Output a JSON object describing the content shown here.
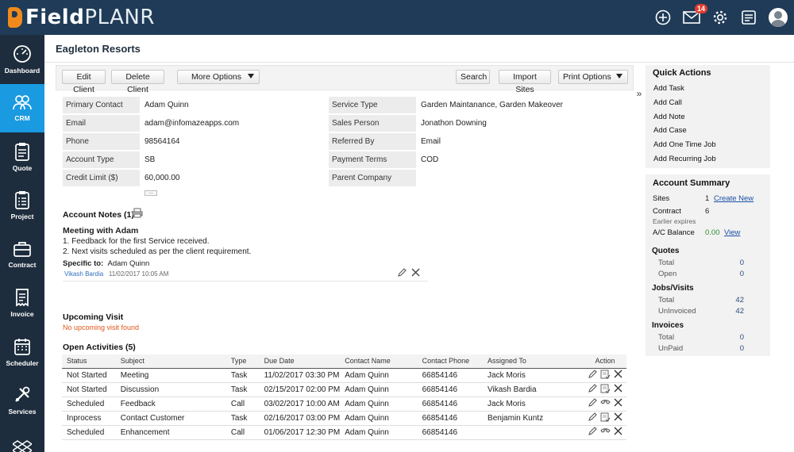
{
  "brand": {
    "bold": "Field",
    "light": "PLANR"
  },
  "topbar": {
    "notification_count": "14"
  },
  "sidebar": {
    "items": [
      {
        "label": "Dashboard",
        "icon": "gauge-icon",
        "active": false
      },
      {
        "label": "CRM",
        "icon": "people-icon",
        "active": true
      },
      {
        "label": "Quote",
        "icon": "clipboard-icon",
        "active": false
      },
      {
        "label": "Project",
        "icon": "clipboard-list-icon",
        "active": false
      },
      {
        "label": "Contract",
        "icon": "briefcase-icon",
        "active": false
      },
      {
        "label": "Invoice",
        "icon": "invoice-icon",
        "active": false
      },
      {
        "label": "Scheduler",
        "icon": "calendar-icon",
        "active": false
      },
      {
        "label": "Services",
        "icon": "tools-icon",
        "active": false
      },
      {
        "label": "",
        "icon": "dropbox-icon",
        "active": false
      }
    ]
  },
  "page": {
    "title": "Eagleton Resorts"
  },
  "toolbar": {
    "edit_client": "Edit Client",
    "delete_client": "Delete Client",
    "more_options": "More Options",
    "search": "Search",
    "import_sites": "Import Sites",
    "print_options": "Print Options"
  },
  "collapse_toggle": "»",
  "details": {
    "left": [
      {
        "label": "Primary Contact",
        "value": "Adam Quinn"
      },
      {
        "label": "Email",
        "value": "adam@infomazeapps.com"
      },
      {
        "label": "Phone",
        "value": "98564164"
      },
      {
        "label": "Account Type",
        "value": "SB"
      },
      {
        "label": "Credit Limit ($)",
        "value": "60,000.00"
      }
    ],
    "right": [
      {
        "label": "Service Type",
        "value": "Garden Maintanance, Garden Makeover"
      },
      {
        "label": "Sales Person",
        "value": "Jonathon Downing"
      },
      {
        "label": "Referred By",
        "value": "Email"
      },
      {
        "label": "Payment Terms",
        "value": "COD"
      },
      {
        "label": "Parent Company",
        "value": ""
      }
    ],
    "more_dots": "..."
  },
  "notes": {
    "heading": "Account Notes (1)",
    "title": "Meeting with Adam",
    "lines": [
      "1. Feedback for the first Service received.",
      "2. Next visits scheduled as per the client requirement."
    ],
    "specific_label": "Specific to:",
    "specific_value": "Adam Quinn",
    "author": "Vikash Bardia",
    "timestamp": "11/02/2017 10:05 AM"
  },
  "upcoming": {
    "heading": "Upcoming Visit",
    "empty_text": "No upcoming visit found"
  },
  "activities": {
    "heading": "Open Activities (5)",
    "columns": [
      "Status",
      "Subject",
      "Type",
      "Due Date",
      "Contact Name",
      "Contact Phone",
      "Assigned To",
      "Action"
    ],
    "rows": [
      {
        "status": "Not Started",
        "subject": "Meeting",
        "type": "Task",
        "due": "11/02/2017 03:30 PM",
        "contact": "Adam Quinn",
        "phone": "66854146",
        "assigned": "Jack Moris"
      },
      {
        "status": "Not Started",
        "subject": "Discussion",
        "type": "Task",
        "due": "02/15/2017 02:00 PM",
        "contact": "Adam Quinn",
        "phone": "66854146",
        "assigned": "Vikash Bardia"
      },
      {
        "status": "Scheduled",
        "subject": "Feedback",
        "type": "Call",
        "due": "03/02/2017 10:00 AM",
        "contact": "Adam Quinn",
        "phone": "66854146",
        "assigned": "Jack Moris"
      },
      {
        "status": "Inprocess",
        "subject": "Contact Customer",
        "type": "Task",
        "due": "02/16/2017 03:00 PM",
        "contact": "Adam Quinn",
        "phone": "66854146",
        "assigned": "Benjamin Kuntz"
      },
      {
        "status": "Scheduled",
        "subject": "Enhancement",
        "type": "Call",
        "due": "01/06/2017 12:30 PM",
        "contact": "Adam Quinn",
        "phone": "66854146",
        "assigned": ""
      }
    ]
  },
  "quick_actions": {
    "title": "Quick Actions",
    "items": [
      "Add Task",
      "Add Call",
      "Add Note",
      "Add Case",
      "Add One Time Job",
      "Add Recurring Job"
    ]
  },
  "summary": {
    "title": "Account Summary",
    "sites_label": "Sites",
    "sites_value": "1",
    "create_new": "Create New",
    "contract_label": "Contract",
    "contract_value": "6",
    "earlier_expires": "Earlier expires",
    "balance_label": "A/C Balance",
    "balance_value": "0.00",
    "view": "View",
    "quotes": {
      "heading": "Quotes",
      "total_label": "Total",
      "total": "0",
      "open_label": "Open",
      "open": "0"
    },
    "jobs": {
      "heading": "Jobs/Visits",
      "total_label": "Total",
      "total": "42",
      "uninvoiced_label": "UnInvoiced",
      "uninvoiced": "42"
    },
    "invoices": {
      "heading": "Invoices",
      "total_label": "Total",
      "total": "0",
      "unpaid_label": "UnPaid",
      "unpaid": "0"
    }
  }
}
